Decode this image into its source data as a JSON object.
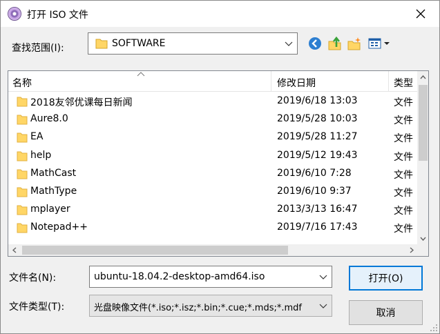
{
  "window": {
    "title": "打开 ISO 文件"
  },
  "toolbar": {
    "lookin_label": "查找范围(I):",
    "current_folder": "SOFTWARE",
    "icons": [
      "back-icon",
      "up-folder-icon",
      "new-folder-icon",
      "view-menu-icon"
    ]
  },
  "filelist": {
    "columns": {
      "name": "名称",
      "date": "修改日期",
      "type": "类型"
    },
    "rows": [
      {
        "name": "2018友邻优课每日新闻",
        "date": "2019/6/18 13:03",
        "type": "文件"
      },
      {
        "name": "Aure8.0",
        "date": "2019/5/28 10:03",
        "type": "文件"
      },
      {
        "name": "EA",
        "date": "2019/5/28 11:27",
        "type": "文件"
      },
      {
        "name": "help",
        "date": "2019/5/12 19:43",
        "type": "文件"
      },
      {
        "name": "MathCast",
        "date": "2019/6/10 7:28",
        "type": "文件"
      },
      {
        "name": "MathType",
        "date": "2019/6/10 9:37",
        "type": "文件"
      },
      {
        "name": "mplayer",
        "date": "2013/3/13 16:47",
        "type": "文件"
      },
      {
        "name": "Notepad++",
        "date": "2019/7/16 17:43",
        "type": "文件"
      }
    ]
  },
  "footer": {
    "filename_label": "文件名(N):",
    "filename_value": "ubuntu-18.04.2-desktop-amd64.iso",
    "filetype_label": "文件类型(T):",
    "filetype_value": "光盘映像文件(*.iso;*.isz;*.bin;*.cue;*.mds;*.mdf",
    "open_button": "打开(O)",
    "cancel_button": "取消"
  },
  "colors": {
    "folder": "#ffd666",
    "accent": "#0078d7",
    "back": "#2d7fd1",
    "up": "#3aa33a"
  }
}
